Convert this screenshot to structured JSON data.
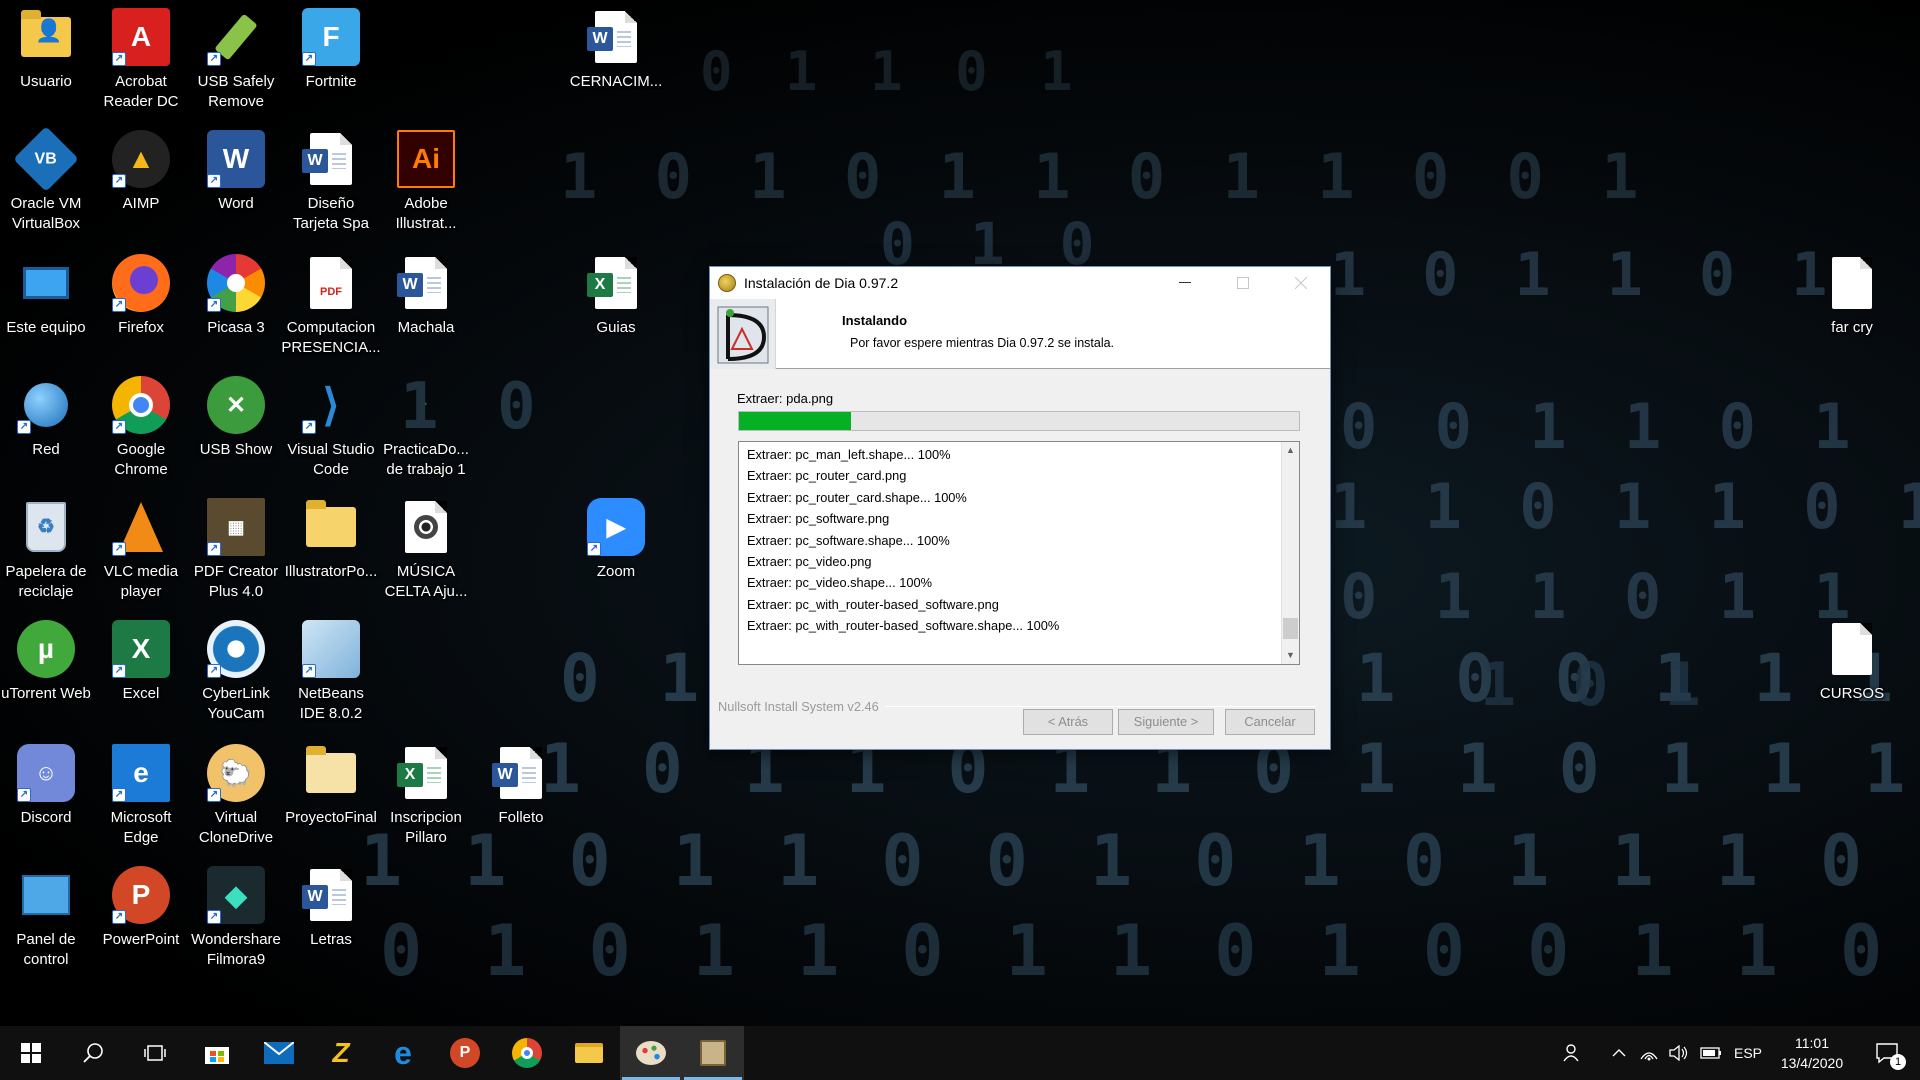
{
  "desktop": {
    "icons": [
      {
        "label": "Usuario",
        "icon": "user-folder-icon"
      },
      {
        "label": "Acrobat Reader DC",
        "icon": "acrobat-icon"
      },
      {
        "label": "USB Safely Remove",
        "icon": "usb-safely-remove-icon"
      },
      {
        "label": "Fortnite",
        "icon": "fortnite-icon"
      },
      {
        "label": "CERNACIM...",
        "icon": "word-document-icon"
      },
      {
        "label": "Oracle VM VirtualBox",
        "icon": "virtualbox-icon"
      },
      {
        "label": "AIMP",
        "icon": "aimp-icon"
      },
      {
        "label": "Word",
        "icon": "word-icon"
      },
      {
        "label": "Diseño Tarjeta Spa",
        "icon": "word-document-icon"
      },
      {
        "label": "Adobe Illustrat...",
        "icon": "illustrator-icon"
      },
      {
        "label": "Este equipo",
        "icon": "computer-icon"
      },
      {
        "label": "Firefox",
        "icon": "firefox-icon"
      },
      {
        "label": "Picasa 3",
        "icon": "picasa-icon"
      },
      {
        "label": "Computacion PRESENCIA...",
        "icon": "pdf-document-icon"
      },
      {
        "label": "Machala",
        "icon": "word-document-icon"
      },
      {
        "label": "Guias",
        "icon": "excel-document-icon"
      },
      {
        "label": "far cry",
        "icon": "blank-file-icon"
      },
      {
        "label": "Red",
        "icon": "network-icon"
      },
      {
        "label": "Google Chrome",
        "icon": "chrome-icon"
      },
      {
        "label": "USB Show",
        "icon": "usb-show-icon"
      },
      {
        "label": "Visual Studio Code",
        "icon": "vscode-icon"
      },
      {
        "label": "PracticaDo... de trabajo 1",
        "icon": "practica-icon"
      },
      {
        "label": "Papelera de reciclaje",
        "icon": "recycle-bin-icon"
      },
      {
        "label": "VLC media player",
        "icon": "vlc-icon"
      },
      {
        "label": "PDF Creator Plus 4.0",
        "icon": "pdf-creator-icon"
      },
      {
        "label": "IllustratorPo...",
        "icon": "folder-icon"
      },
      {
        "label": "MÚSICA CELTA Aju...",
        "icon": "music-file-icon"
      },
      {
        "label": "Zoom",
        "icon": "zoom-icon"
      },
      {
        "label": "uTorrent Web",
        "icon": "utorrent-icon"
      },
      {
        "label": "Excel",
        "icon": "excel-icon"
      },
      {
        "label": "CyberLink YouCam",
        "icon": "youcam-icon"
      },
      {
        "label": "NetBeans IDE 8.0.2",
        "icon": "netbeans-icon"
      },
      {
        "label": "CURSOS",
        "icon": "blank-file-icon"
      },
      {
        "label": "Discord",
        "icon": "discord-icon"
      },
      {
        "label": "Microsoft Edge",
        "icon": "edge-icon"
      },
      {
        "label": "Virtual CloneDrive",
        "icon": "clonedrive-icon"
      },
      {
        "label": "ProyectoFinal",
        "icon": "folder-icon"
      },
      {
        "label": "Inscripcion Pillaro",
        "icon": "excel-document-icon"
      },
      {
        "label": "Folleto",
        "icon": "word-document-icon"
      },
      {
        "label": "Panel de control",
        "icon": "control-panel-icon"
      },
      {
        "label": "PowerPoint",
        "icon": "powerpoint-icon"
      },
      {
        "label": "Wondershare Filmora9",
        "icon": "filmora-icon"
      },
      {
        "label": "Letras",
        "icon": "word-document-icon"
      }
    ]
  },
  "installer": {
    "title": "Instalación de Dia 0.97.2",
    "heading": "Instalando",
    "subheading": "Por favor espere mientras Dia 0.97.2 se instala.",
    "current_action": "Extraer: pda.png",
    "progress": 0.2,
    "progress_color": "#06b025",
    "log_lines": [
      "Extraer: pc_man_left.shape... 100%",
      "Extraer: pc_router_card.png",
      "Extraer: pc_router_card.shape... 100%",
      "Extraer: pc_software.png",
      "Extraer: pc_software.shape... 100%",
      "Extraer: pc_video.png",
      "Extraer: pc_video.shape... 100%",
      "Extraer: pc_with_router-based_software.png",
      "Extraer: pc_with_router-based_software.shape... 100%"
    ],
    "brand": "Nullsoft Install System v2.46",
    "buttons": {
      "back": "< Atrás",
      "next": "Siguiente >",
      "cancel": "Cancelar"
    }
  },
  "taskbar": {
    "apps": [
      {
        "name": "start-button",
        "icon": "windows-logo-icon"
      },
      {
        "name": "search-button",
        "icon": "search-icon"
      },
      {
        "name": "task-view-button",
        "icon": "task-view-icon"
      },
      {
        "name": "taskbar-store",
        "icon": "store-icon"
      },
      {
        "name": "taskbar-mail",
        "icon": "mail-icon"
      },
      {
        "name": "taskbar-filezilla",
        "icon": "z-app-icon"
      },
      {
        "name": "taskbar-edge",
        "icon": "edge-icon"
      },
      {
        "name": "taskbar-powerpoint",
        "icon": "powerpoint-icon"
      },
      {
        "name": "taskbar-chrome",
        "icon": "chrome-icon"
      },
      {
        "name": "taskbar-file-explorer",
        "icon": "folder-icon"
      },
      {
        "name": "taskbar-paint",
        "icon": "paint-icon"
      },
      {
        "name": "taskbar-installer",
        "icon": "installer-icon"
      }
    ],
    "language": "ESP",
    "time": "11:01",
    "date": "13/4/2020",
    "notification_count": "1"
  }
}
